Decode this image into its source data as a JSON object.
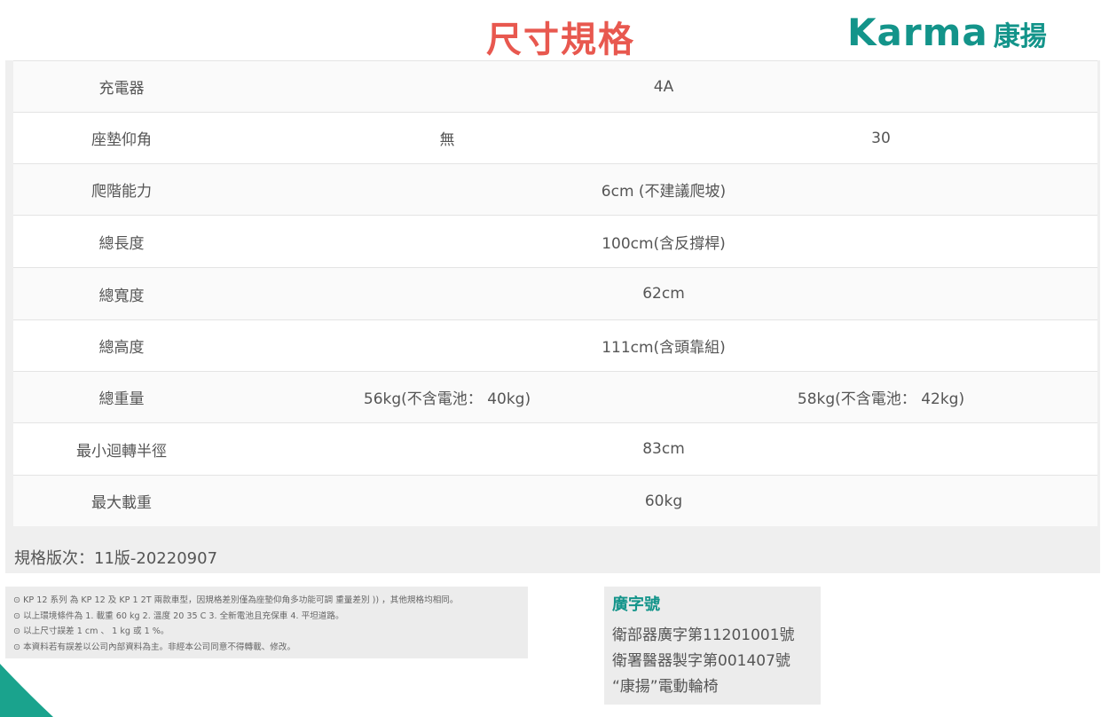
{
  "header": {
    "title": "尺寸規格",
    "brand_en": "Karma",
    "brand_zh": "康揚"
  },
  "specs": [
    {
      "label": "充電器",
      "value": "4A"
    },
    {
      "label": "座墊仰角",
      "value_a": "無",
      "value_b": "30"
    },
    {
      "label": "爬階能力",
      "value": "6cm (不建議爬坡)"
    },
    {
      "label": "總長度",
      "value": "100cm(含反撐桿)"
    },
    {
      "label": "總寬度",
      "value": "62cm"
    },
    {
      "label": "總高度",
      "value": "111cm(含頭靠組)"
    },
    {
      "label": "總重量",
      "value_a": "56kg(不含電池： 40kg)",
      "value_b": "58kg(不含電池： 42kg)"
    },
    {
      "label": "最小迴轉半徑",
      "value": "83cm"
    },
    {
      "label": "最大載重",
      "value": "60kg"
    }
  ],
  "version": "規格版次：11版-20220907",
  "notes": [
    "⊙ KP 12 系列 為 KP 12 及 KP 1 2T 兩款車型，因規格差別僅為座墊仰角多功能可調 重量差別 )) ，其他規格均相同。",
    "⊙ 以上環境條件為 1. 載重 60 kg 2. 溫度 20 35 C 3. 全新電池且充保車 4. 平坦道路。",
    "⊙ 以上尺寸誤差 1 cm 、 1 kg 或 1 %。",
    "⊙ 本資料若有誤差以公司內部資料為主。非經本公司同意不得轉載、修改。"
  ],
  "license": {
    "title": "廣字號",
    "lines": [
      "衛部器廣字第11201001號",
      "衛署醫器製字第001407號",
      "“康揚”電動輪椅"
    ]
  },
  "colors": {
    "brand": "#13948a",
    "title": "#e8584f",
    "corner": "#1aa38d"
  }
}
